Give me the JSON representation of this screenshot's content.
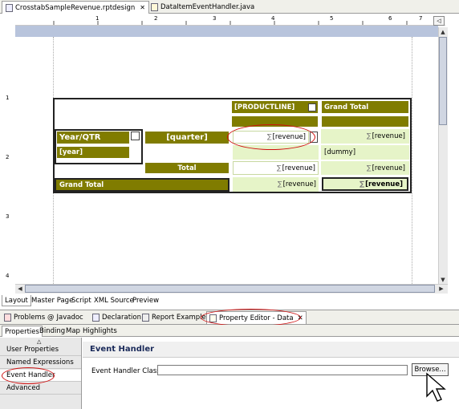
{
  "editor_tabs": [
    {
      "label": "CrosstabSampleRevenue.rptdesign",
      "close": "✕"
    },
    {
      "label": "DataItemEventHandler.java"
    }
  ],
  "ruler_numbers": [
    "1",
    "2",
    "3",
    "4",
    "5",
    "6",
    "7"
  ],
  "ruler_left_numbers": [
    "1",
    "2",
    "3",
    "4"
  ],
  "crosstab": {
    "productline": "[PRODUCTLINE]",
    "grand_total": "Grand Total",
    "year_qtr": "Year/QTR",
    "year": "[year]",
    "quarter": "[quarter]",
    "revenue": "[revenue]",
    "sigma": "∑",
    "dummy": "[dummy]",
    "total": "Total",
    "grand_total_row": "Grand Total"
  },
  "content_tabs": [
    "Layout",
    "Master Page",
    "Script",
    "XML Source",
    "Preview"
  ],
  "view_tabs": [
    "Problems",
    "Javadoc",
    "Declaration",
    "Report Examples",
    "Property Editor - Data"
  ],
  "view_tab_close": "✕",
  "sub_tabs": [
    "Properties",
    "Binding",
    "Map",
    "Highlights"
  ],
  "nav_items": [
    "User Properties",
    "Named Expressions",
    "Event Handler",
    "Advanced"
  ],
  "panel": {
    "title": "Event Handler",
    "field_label": "Event Handler Class:",
    "field_value": "",
    "browse": "Browse..."
  },
  "colors": {
    "olive": "#807c00",
    "light_green": "#e6f4c8",
    "highlight": "#d01010"
  }
}
